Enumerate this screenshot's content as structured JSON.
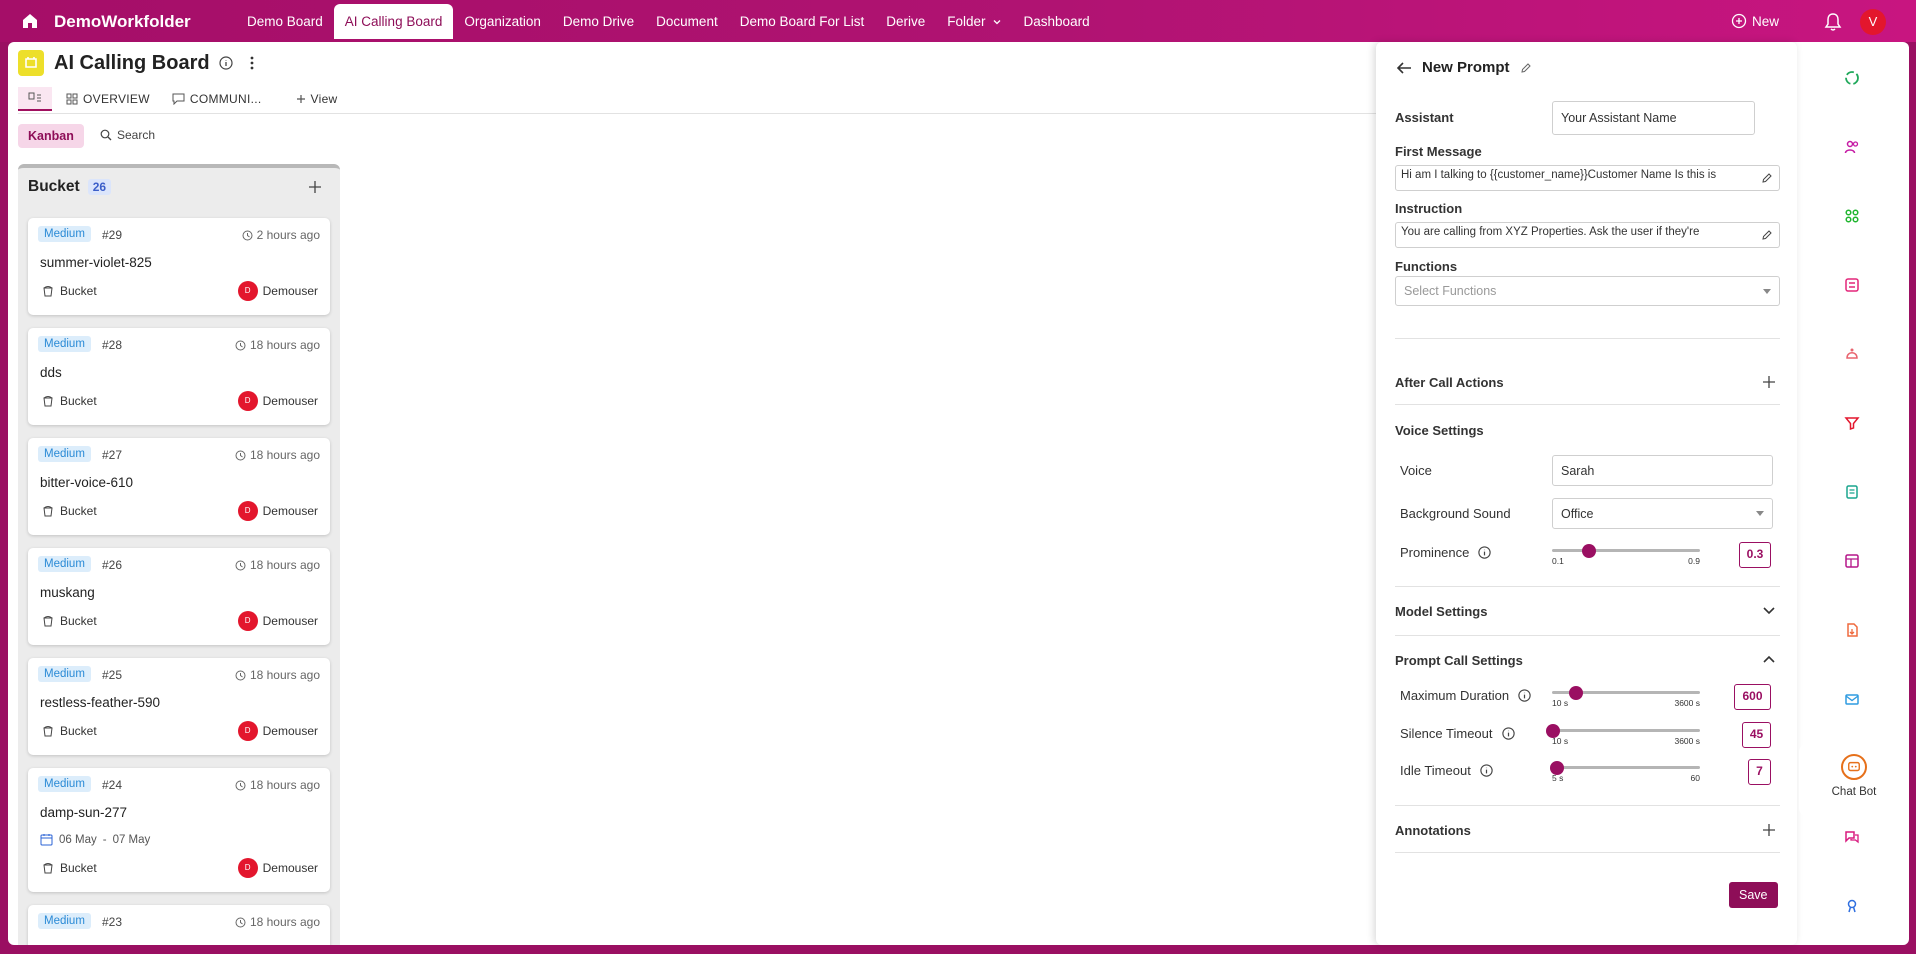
{
  "app": {
    "title": "DemoWorkfolder",
    "new_label": "New",
    "avatar_initial": "V"
  },
  "nav": {
    "items": [
      "Demo Board",
      "AI Calling Board",
      "Organization",
      "Demo Drive",
      "Document",
      "Demo Board For List",
      "Derive",
      "Folder",
      "Dashboard"
    ],
    "active": "AI Calling Board"
  },
  "board": {
    "title": "AI Calling Board",
    "tabs": {
      "overview": "OVERVIEW",
      "communi": "COMMUNI...",
      "view": "View"
    },
    "kanban_label": "Kanban",
    "search_label": "Search"
  },
  "column": {
    "name": "Bucket",
    "count": "26",
    "cards": [
      {
        "priority": "Medium",
        "id": "#29",
        "time": "2 hours ago",
        "title": "summer-violet-825",
        "bucket": "Bucket",
        "user": "Demouser",
        "user_initial": "D"
      },
      {
        "priority": "Medium",
        "id": "#28",
        "time": "18 hours ago",
        "title": "dds",
        "bucket": "Bucket",
        "user": "Demouser",
        "user_initial": "D"
      },
      {
        "priority": "Medium",
        "id": "#27",
        "time": "18 hours ago",
        "title": "bitter-voice-610",
        "bucket": "Bucket",
        "user": "Demouser",
        "user_initial": "D"
      },
      {
        "priority": "Medium",
        "id": "#26",
        "time": "18 hours ago",
        "title": "muskang",
        "bucket": "Bucket",
        "user": "Demouser",
        "user_initial": "D"
      },
      {
        "priority": "Medium",
        "id": "#25",
        "time": "18 hours ago",
        "title": "restless-feather-590",
        "bucket": "Bucket",
        "user": "Demouser",
        "user_initial": "D"
      },
      {
        "priority": "Medium",
        "id": "#24",
        "time": "18 hours ago",
        "title": "damp-sun-277",
        "date_from": "06 May",
        "date_sep": "-",
        "date_to": "07 May",
        "bucket": "Bucket",
        "user": "Demouser",
        "user_initial": "D"
      },
      {
        "priority": "Medium",
        "id": "#23",
        "time": "18 hours ago"
      }
    ]
  },
  "panel": {
    "title": "New Prompt",
    "assistant_label": "Assistant",
    "assistant_value": "Your Assistant Name",
    "first_message_label": "First Message",
    "first_message_value": "Hi am I talking to {{customer_name}}Customer Name    Is this is",
    "instruction_label": "Instruction",
    "instruction_value": "You are calling from XYZ Properties. Ask the user if they're",
    "functions_label": "Functions",
    "functions_placeholder": "Select Functions",
    "after_call_label": "After Call Actions",
    "voice_settings_label": "Voice Settings",
    "voice_label": "Voice",
    "voice_value": "Sarah",
    "bg_sound_label": "Background Sound",
    "bg_sound_value": "Office",
    "prominence": {
      "label": "Prominence",
      "min": "0.1",
      "max": "0.9",
      "value": "0.3",
      "fraction": 0.25
    },
    "model_settings_label": "Model Settings",
    "prompt_call_label": "Prompt Call Settings",
    "max_duration": {
      "label": "Maximum Duration",
      "min": "10 s",
      "max": "3600 s",
      "value": "600",
      "fraction": 0.164
    },
    "silence_timeout": {
      "label": "Silence Timeout",
      "min": "10 s",
      "max": "3600 s",
      "value": "45",
      "fraction": 0.01
    },
    "idle_timeout": {
      "label": "Idle Timeout",
      "min": "5 s",
      "max": "60",
      "value": "7",
      "fraction": 0.036
    },
    "annotations_label": "Annotations",
    "save_label": "Save"
  },
  "sidebar": {
    "items": [
      {
        "label": "Process",
        "icon": "process-icon",
        "color": "#1fa85a"
      },
      {
        "label": "Members",
        "icon": "members-icon",
        "color": "#c51aa4"
      },
      {
        "label": "Apps",
        "icon": "apps-icon",
        "color": "#1fb52e"
      },
      {
        "label": "Attributes",
        "icon": "attributes-icon",
        "color": "#e3267a"
      },
      {
        "label": "Phases",
        "icon": "phases-icon",
        "color": "#e8646f"
      },
      {
        "label": "Quick Filter",
        "icon": "filter-icon",
        "color": "#e3162d"
      },
      {
        "label": "Forms",
        "icon": "forms-icon",
        "color": "#1aa58e"
      },
      {
        "label": "Template",
        "icon": "template-icon",
        "color": "#b5178a"
      },
      {
        "label": "Import/Export",
        "icon": "import-export-icon",
        "color": "#ef6a3e"
      },
      {
        "label": "Email",
        "icon": "email-icon",
        "color": "#2f9be0"
      },
      {
        "label": "Chat Bot",
        "icon": "chat-bot-icon",
        "color": "#e6701a"
      },
      {
        "label": "Channels",
        "icon": "channels-icon",
        "color": "#d81a7f"
      },
      {
        "label": "Automation",
        "icon": "automation-icon",
        "color": "#2f6fe0"
      }
    ],
    "active": "Chat Bot"
  },
  "colors": {
    "brand": "#9a0f62",
    "accent": "#8e0e58",
    "badge_bg": "#dcedfb",
    "badge_text": "#2a8ad6"
  }
}
